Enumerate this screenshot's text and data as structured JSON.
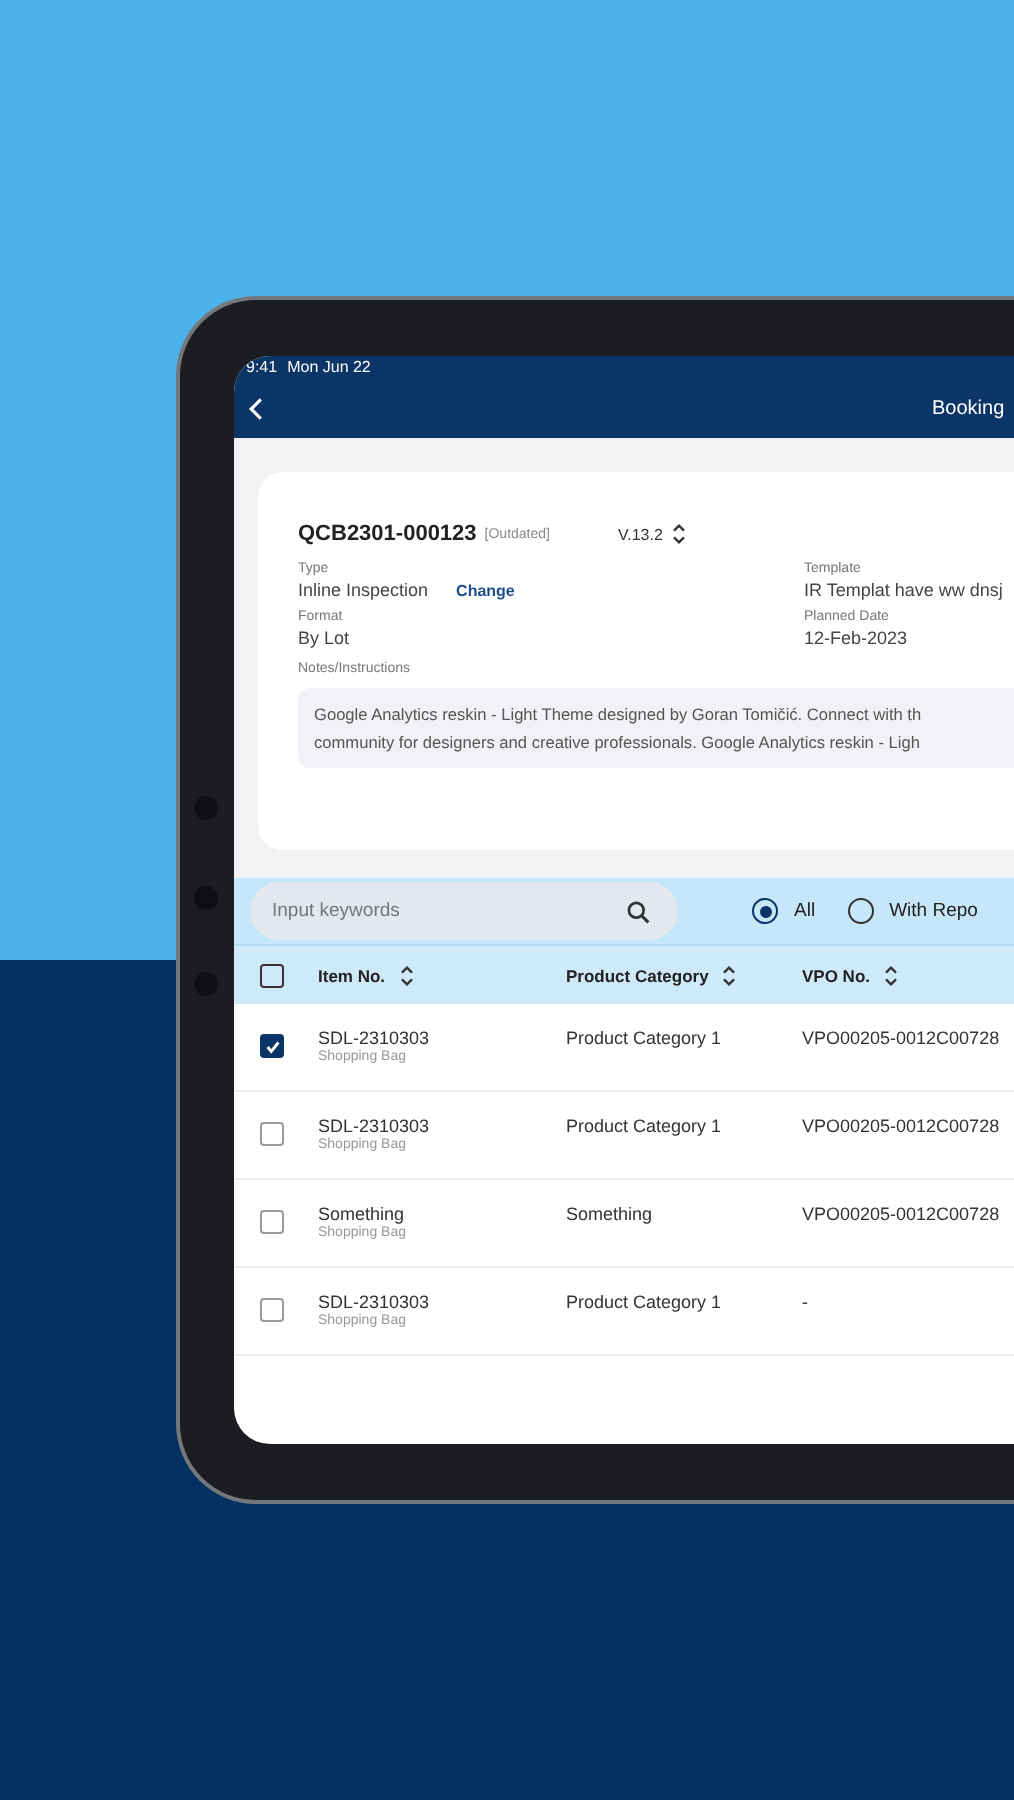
{
  "status_bar": {
    "time": "9:41",
    "date": "Mon Jun 22"
  },
  "nav": {
    "title": "Booking"
  },
  "booking": {
    "code": "QCB2301-000123",
    "status": "[Outdated]",
    "version": "V.13.2",
    "fields": [
      {
        "label": "Type",
        "value": "Inline Inspection",
        "action": "Change"
      },
      {
        "label": "Template",
        "value": "IR Templat have ww dnsj"
      },
      {
        "label": "Format",
        "value": "By Lot"
      },
      {
        "label": "Planned Date",
        "value": "12-Feb-2023"
      }
    ],
    "notes_label": "Notes/Instructions",
    "notes_lines": [
      "Google Analytics reskin - Light Theme designed by Goran Tomičić. Connect with th",
      "community for designers and creative professionals. Google Analytics reskin - Ligh"
    ]
  },
  "search": {
    "placeholder": "Input keywords"
  },
  "filters": [
    {
      "label": "All",
      "selected": true
    },
    {
      "label": "With Repo",
      "selected": false
    }
  ],
  "table": {
    "select_all": {
      "checked": false
    },
    "columns": [
      "Item No.",
      "Product Category",
      "VPO No."
    ],
    "rows": [
      {
        "checked": true,
        "item": "SDL-2310303",
        "item_sub": "Shopping Bag",
        "category": "Product Category 1",
        "vpo": "VPO00205-0012C00728"
      },
      {
        "checked": false,
        "item": "SDL-2310303",
        "item_sub": "Shopping Bag",
        "category": "Product Category 1",
        "vpo": "VPO00205-0012C00728"
      },
      {
        "checked": false,
        "item": "Something",
        "item_sub": "Shopping Bag",
        "category": "Something",
        "vpo": "VPO00205-0012C00728"
      },
      {
        "checked": false,
        "item": "SDL-2310303",
        "item_sub": "Shopping Bag",
        "category": "Product Category 1",
        "vpo": "-"
      }
    ]
  }
}
